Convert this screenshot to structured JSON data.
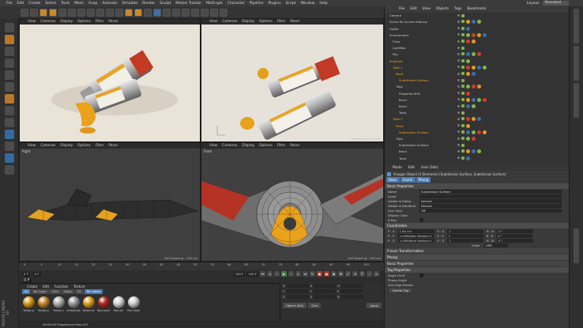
{
  "menubar": {
    "items": [
      "File",
      "Edit",
      "Create",
      "Select",
      "Tools",
      "Mesh",
      "Snap",
      "Animate",
      "Simulate",
      "Render",
      "Sculpt",
      "Motion Tracker",
      "MoGraph",
      "Character",
      "Pipeline",
      "Plugins",
      "Script",
      "Window",
      "Help"
    ],
    "layout_label": "Layout:",
    "layout_value": "Standard"
  },
  "viewports": {
    "menu": [
      "View",
      "Cameras",
      "Display",
      "Options",
      "Filter",
      "Panel"
    ],
    "bottom_left": {
      "label": "Right",
      "grid": "Grid Spacing : 100 cm"
    },
    "bottom_right": {
      "label": "Front",
      "grid": "Grid Spacing : 100 cm"
    },
    "top_right": {
      "footer": "Subdivision Surface"
    }
  },
  "object_manager": {
    "menu": [
      "File",
      "Edit",
      "View",
      "Objects",
      "Tags",
      "Bookmarks"
    ],
    "rows": [
      {
        "name": "Camera",
        "indent": 0,
        "selected": false
      },
      {
        "name": "Scene Kit Access Kadung",
        "indent": 0,
        "selected": false
      },
      {
        "name": "Lights",
        "indent": 0,
        "selected": false
      },
      {
        "name": "Environment",
        "indent": 0,
        "selected": false
      },
      {
        "name": "Floor",
        "indent": 1,
        "selected": false
      },
      {
        "name": "LightBox",
        "indent": 1,
        "selected": false
      },
      {
        "name": "Sky",
        "indent": 1,
        "selected": false
      },
      {
        "name": "Products",
        "indent": 0,
        "selected": true
      },
      {
        "name": "Tube 1",
        "indent": 1,
        "selected": true
      },
      {
        "name": "Paint",
        "indent": 2,
        "selected": true
      },
      {
        "name": "Subdivision Surface",
        "indent": 3,
        "selected": true
      },
      {
        "name": "Tube",
        "indent": 2,
        "selected": false
      },
      {
        "name": "Flowerfix.HHH",
        "indent": 3,
        "selected": false
      },
      {
        "name": "Bend",
        "indent": 3,
        "selected": false
      },
      {
        "name": "Bend",
        "indent": 3,
        "selected": false
      },
      {
        "name": "Twist",
        "indent": 3,
        "selected": false
      },
      {
        "name": "Tube 2",
        "indent": 1,
        "selected": true
      },
      {
        "name": "Paint",
        "indent": 2,
        "selected": true
      },
      {
        "name": "Subdivision Surface",
        "indent": 3,
        "selected": true
      },
      {
        "name": "Tube",
        "indent": 2,
        "selected": false
      },
      {
        "name": "Subdivision Surface",
        "indent": 3,
        "selected": false
      },
      {
        "name": "Bend",
        "indent": 3,
        "selected": false
      },
      {
        "name": "Twist",
        "indent": 3,
        "selected": false
      }
    ]
  },
  "attributes": {
    "menu": [
      "Mode",
      "Edit",
      "User Data"
    ],
    "title": "Polygon Object [4 Elements] (Subdivision Surface, Subdivision Surface)",
    "tabs": [
      "Basic",
      "Coord.",
      "Phong"
    ],
    "basic_header": "Basic Properties",
    "fields": [
      {
        "label": "Name",
        "value": "Subdivision Surface"
      },
      {
        "label": "Layer",
        "value": ""
      },
      {
        "label": "Visible in Editor",
        "value": "Default"
      },
      {
        "label": "Visible in Renderer",
        "value": "Default"
      },
      {
        "label": "Use Color",
        "value": "Off"
      },
      {
        "label": "Display Color",
        "value": ""
      },
      {
        "label": "X-Ray",
        "value": ""
      }
    ],
    "coord_header": "Coordinates",
    "coords": [
      {
        "axis": "P . X",
        "v1": "1.84 cm",
        "s": "S . X",
        "v2": "1",
        "r": "R . H",
        "v3": "0 °"
      },
      {
        "axis": "P . Y",
        "v1": "<<Multiple Values>>",
        "s": "S . Y",
        "v2": "1",
        "r": "R . P",
        "v3": "0 °"
      },
      {
        "axis": "P . Z",
        "v1": "<<Multiple Values>>",
        "s": "S . Z",
        "v2": "1",
        "r": "R . B",
        "v3": "0 °"
      }
    ],
    "order_label": "Order",
    "order_value": "HPB",
    "freeze": "Freeze Transformation",
    "phong_header": "Phong",
    "phong_sub": "Basic Properties",
    "tag_props": "Tag Properties",
    "angle_limit": "Angle Limit",
    "phong_angle": "Phong Angle",
    "use_edge": "Use Edge Breaks",
    "delete_btn": "Delete Tag"
  },
  "timeline": {
    "ticks": [
      "0",
      "5",
      "10",
      "15",
      "20",
      "25",
      "30",
      "35",
      "40",
      "45",
      "50",
      "55",
      "60",
      "65",
      "70",
      "75",
      "80",
      "85",
      "90",
      "95",
      "100"
    ],
    "current": "0 F",
    "start": "0 F",
    "end": "100 F",
    "end2": "100 F",
    "frame": "0 F"
  },
  "material_manager": {
    "menu": [
      "Create",
      "Edit",
      "Function",
      "Texture"
    ],
    "filters": [
      "All",
      "No Layer",
      "Chm",
      "Glass",
      "Tin",
      "Re Labels"
    ],
    "materials": [
      {
        "label": "Yellow g",
        "color": "#d89a1c"
      },
      {
        "label": "Yellow p",
        "color": "#c8862a"
      },
      {
        "label": "Yellow s",
        "color": "#b0b0b0"
      },
      {
        "label": "metaltube",
        "color": "#9a9a9a"
      },
      {
        "label": "Yellow ta",
        "color": "#e0a020"
      },
      {
        "label": "Red paint",
        "color": "#b2281c"
      },
      {
        "label": "Red wh",
        "color": "#d6d6d6"
      },
      {
        "label": "Red label",
        "color": "#cfcfcf"
      }
    ]
  },
  "coord_manager": {
    "mode": "Object (Rel)",
    "size": "Size",
    "apply": "Apply"
  },
  "status": {
    "text": "00:00:00 Progressive Pass 4/3"
  },
  "brand": "MAXON CINEMA 4D"
}
